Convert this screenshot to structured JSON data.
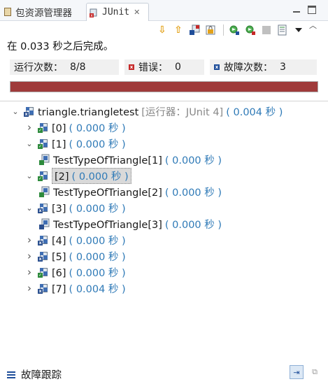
{
  "tabs": [
    {
      "label": "包资源管理器",
      "active": false
    },
    {
      "label": "JUnit",
      "active": true,
      "close": "✕"
    }
  ],
  "status": "在 0.033 秒之后完成。",
  "counters": {
    "runs_label": "运行次数：",
    "runs_value": "8/8",
    "errors_label": "错误：",
    "errors_value": "0",
    "failures_label": "故障次数：",
    "failures_value": "3"
  },
  "progress": {
    "fraction": 1.0,
    "color": "#9f3a3a"
  },
  "tree": [
    {
      "label": "triangle.triangletest",
      "extra": "[运行器：JUnit 4]",
      "time": "( 0.004 秒 )",
      "level": 0,
      "expanded": true,
      "kind": "suite-fail"
    },
    {
      "label": "[0]",
      "time": "( 0.000 秒 )",
      "level": 1,
      "expanded": false,
      "kind": "suite-pass"
    },
    {
      "label": "[1]",
      "time": "( 0.000 秒 )",
      "level": 1,
      "expanded": true,
      "kind": "suite-pass"
    },
    {
      "label": "TestTypeOfTriangle[1]",
      "time": "( 0.000 秒 )",
      "level": 2,
      "kind": "case-pass"
    },
    {
      "label": "[2]",
      "time": "( 0.000 秒 )",
      "level": 1,
      "expanded": true,
      "kind": "suite-pass",
      "selected": true
    },
    {
      "label": "TestTypeOfTriangle[2]",
      "time": "( 0.000 秒 )",
      "level": 2,
      "kind": "case-pass"
    },
    {
      "label": "[3]",
      "time": "( 0.000 秒 )",
      "level": 1,
      "expanded": true,
      "kind": "suite-fail"
    },
    {
      "label": "TestTypeOfTriangle[3]",
      "time": "( 0.000 秒 )",
      "level": 2,
      "kind": "case-fail"
    },
    {
      "label": "[4]",
      "time": "( 0.000 秒 )",
      "level": 1,
      "expanded": false,
      "kind": "suite-fail"
    },
    {
      "label": "[5]",
      "time": "( 0.000 秒 )",
      "level": 1,
      "expanded": false,
      "kind": "suite-fail"
    },
    {
      "label": "[6]",
      "time": "( 0.000 秒 )",
      "level": 1,
      "expanded": false,
      "kind": "suite-pass"
    },
    {
      "label": "[7]",
      "time": "( 0.004 秒 )",
      "level": 1,
      "expanded": false,
      "kind": "suite-fail"
    }
  ],
  "bottom": {
    "label": "故障跟踪"
  },
  "icons": {
    "next_failure": "arrow-down-icon",
    "prev_failure": "arrow-up-icon",
    "show_failures_only": "failures-filter-icon",
    "scroll_lock": "scroll-lock-icon",
    "rerun": "rerun-icon",
    "rerun_failed_first": "rerun-failed-icon",
    "stop": "stop-icon",
    "history": "history-icon",
    "view_menu": "view-menu-icon"
  },
  "colors": {
    "time": "#2f7ab7",
    "error": "#c62828",
    "failure": "#1f4e9a",
    "pass": "#2e8b3d"
  }
}
